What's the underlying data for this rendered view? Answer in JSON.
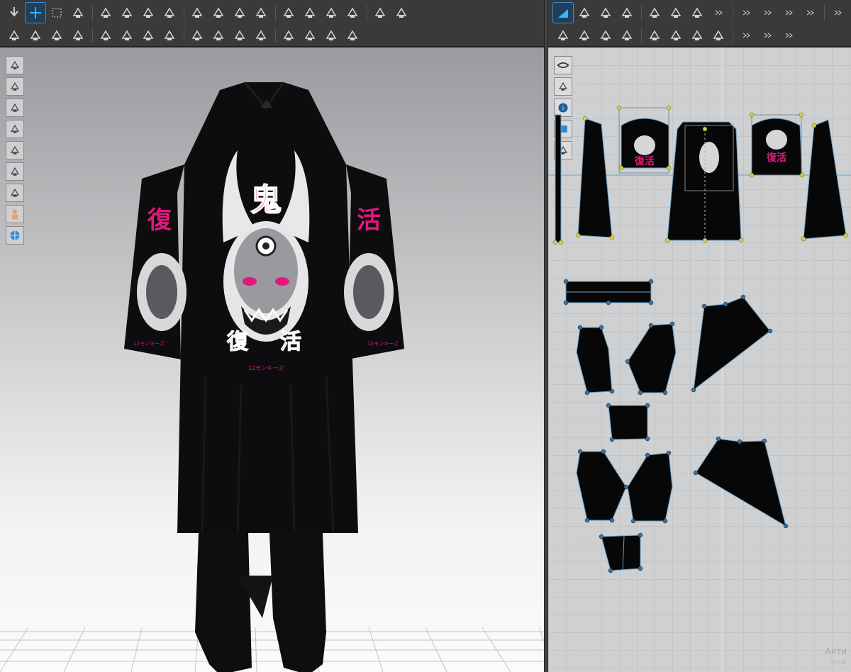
{
  "app": {
    "accent_color": "#3a8ccf",
    "print_color": "#e0197d",
    "garment_color": "#0b0b0c"
  },
  "toolbar_top_left": [
    {
      "icon": "down-arrow-icon"
    },
    {
      "icon": "select-move-icon",
      "active": true
    },
    {
      "icon": "select-mesh-icon"
    },
    {
      "icon": "fold-arrange-icon"
    },
    {
      "icon": "fold-icon"
    },
    {
      "icon": "rotate-icon"
    },
    {
      "icon": "transform-icon"
    },
    {
      "icon": "needle-icon"
    },
    {
      "icon": "pin-icon"
    },
    {
      "icon": "arrange-icon"
    },
    {
      "icon": "shirt-icon"
    },
    {
      "icon": "shirt-alt-icon"
    },
    {
      "icon": "avatar-icon"
    },
    {
      "icon": "button-icon"
    },
    {
      "icon": "measure-icon"
    },
    {
      "icon": "tape-icon"
    },
    {
      "icon": "shirt-stripe-icon"
    },
    {
      "icon": "shirt-check-icon"
    }
  ],
  "toolbar_bottom_left": [
    {
      "icon": "walk-icon"
    },
    {
      "icon": "pin-tool-icon"
    },
    {
      "icon": "tack-icon"
    },
    {
      "icon": "steam-icon"
    },
    {
      "icon": "shrink-icon"
    },
    {
      "icon": "shirt-layer-icon"
    },
    {
      "icon": "pattern-icon"
    },
    {
      "icon": "checker-icon"
    },
    {
      "icon": "add-point-icon"
    },
    {
      "icon": "button-round-icon"
    },
    {
      "icon": "lock-icon"
    },
    {
      "icon": "zipper-icon"
    },
    {
      "icon": "grading-icon"
    },
    {
      "icon": "fold-angle-icon"
    },
    {
      "icon": "gradient-icon"
    },
    {
      "icon": "split-icon"
    }
  ],
  "toolbar_top_right": [
    {
      "icon": "edit-pattern-icon",
      "active": true
    },
    {
      "icon": "edit-curve-icon"
    },
    {
      "icon": "edit-point-icon"
    },
    {
      "icon": "polygon-icon"
    },
    {
      "icon": "rectangle-icon"
    },
    {
      "icon": "ellipse-icon"
    },
    {
      "icon": "internal-polygon-icon"
    },
    {
      "icon": "more-icon"
    },
    {
      "icon": "more-icon"
    },
    {
      "icon": "more-icon"
    },
    {
      "icon": "more-icon"
    },
    {
      "icon": "more-icon"
    },
    {
      "icon": "more-icon"
    },
    {
      "icon": "more-icon"
    }
  ],
  "toolbar_bottom_right": [
    {
      "icon": "transform-pattern-icon"
    },
    {
      "icon": "fold-pattern-icon"
    },
    {
      "icon": "steam-pattern-icon"
    },
    {
      "icon": "pin-pattern-icon"
    },
    {
      "icon": "iron-icon"
    },
    {
      "icon": "garment-icon"
    },
    {
      "icon": "garment-layer-icon"
    },
    {
      "icon": "arrange-pattern-icon"
    },
    {
      "icon": "more-icon"
    },
    {
      "icon": "more-icon"
    },
    {
      "icon": "more-icon"
    }
  ],
  "sidetools_3d": [
    {
      "icon": "cube-icon"
    },
    {
      "icon": "shirt-view-icon"
    },
    {
      "icon": "shirt-texture-icon"
    },
    {
      "icon": "brush-icon"
    },
    {
      "icon": "avatar-view-icon"
    },
    {
      "icon": "stack-icon"
    },
    {
      "icon": "surface-icon"
    },
    {
      "icon": "avatar-skin-icon"
    },
    {
      "icon": "globe-icon"
    }
  ],
  "sidetools_2d": [
    {
      "icon": "eye-icon"
    },
    {
      "icon": "shirt-outline-icon"
    },
    {
      "icon": "info-icon"
    },
    {
      "icon": "texture-layer-icon"
    },
    {
      "icon": "shirt-white-icon"
    }
  ],
  "garment_print": {
    "kanji_top": "鬼",
    "kanji_left": "復",
    "kanji_right": "活",
    "kanji_bottom_left": "復",
    "kanji_bottom_right": "活",
    "caption": "12モンキーズ",
    "sleeve_caption_left": "12モンキーズ",
    "sleeve_caption_right": "12モンキーズ",
    "sleeve_kanji_left": "復活",
    "sleeve_kanji_right": "復活"
  },
  "pattern_print": {
    "kanji_a": "復活",
    "kanji_b": "復活"
  },
  "watermark": {
    "line1": "Акти",
    "line2": "Чтоб"
  }
}
